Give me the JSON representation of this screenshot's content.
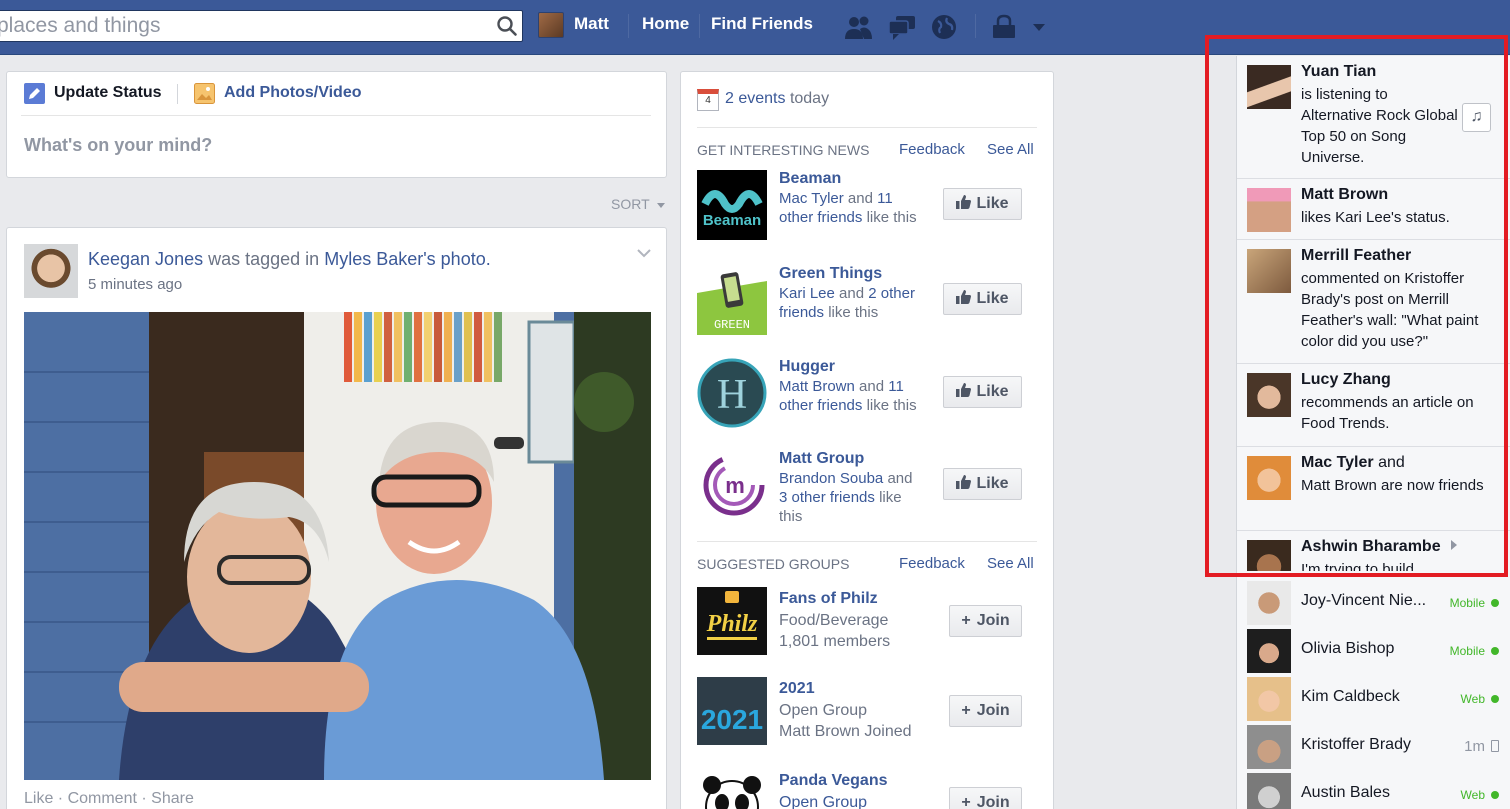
{
  "header": {
    "search_placeholder": "places and things",
    "user_name": "Matt",
    "home": "Home",
    "find_friends": "Find Friends"
  },
  "composer": {
    "update_status": "Update Status",
    "add_photos": "Add Photos/Video",
    "placeholder": "What's on your mind?"
  },
  "feed": {
    "sort": "SORT",
    "story": {
      "actor": "Keegan Jones",
      "verb": "was tagged in",
      "object": "Myles Baker's photo.",
      "time": "5 minutes ago",
      "actions": "Like · Comment · Share"
    }
  },
  "rhs": {
    "events_count": "2 events",
    "events_suffix": "today",
    "events_day": "4",
    "news": {
      "title": "GET INTERESTING NEWS",
      "feedback": "Feedback",
      "see_all": "See All",
      "like_label": "Like",
      "pages": [
        {
          "name": "Beaman",
          "friends": "Mac Tyler",
          "and": "and",
          "others": "11 other friends",
          "tail": "like this",
          "logo_text": "Beaman"
        },
        {
          "name": "Green Things",
          "friends": "Kari Lee",
          "and": "and",
          "others": "2 other friends",
          "tail": "like this",
          "logo_text": "GREEN"
        },
        {
          "name": "Hugger",
          "friends": "Matt Brown",
          "and": "and",
          "others": "11 other friends",
          "tail": "like this",
          "logo_text": "H"
        },
        {
          "name": "Matt Group",
          "friends": "Brandon Souba",
          "and": "and",
          "others": "3 other friends",
          "tail": "like this",
          "logo_text": "m"
        }
      ]
    },
    "groups": {
      "title": "SUGGESTED GROUPS",
      "feedback": "Feedback",
      "see_all": "See All",
      "join_label": "Join",
      "items": [
        {
          "name": "Fans of Philz",
          "line1": "Food/Beverage",
          "line2": "1,801 members",
          "logo_text": "Philz"
        },
        {
          "name": "2021",
          "line1": "Open Group",
          "line2": "Matt Brown Joined",
          "logo_text": "2021"
        },
        {
          "name": "Panda Vegans",
          "line1": "Open Group",
          "line2": ""
        }
      ]
    }
  },
  "ticker": [
    {
      "name": "Yuan Tian",
      "text": "is listening to Alternative Rock Global Top 50 on Song Universe.",
      "avatar": "#3a2a22"
    },
    {
      "name": "Matt Brown",
      "text": "likes Kari Lee's status.",
      "avatar": "#d77a9a"
    },
    {
      "name": "Merrill Feather",
      "text": "commented on Kristoffer Brady's post on Merrill Feather's wall: \"What paint color did you use?\"",
      "avatar": "#b88660"
    },
    {
      "name": "Lucy Zhang",
      "text": "recommends an article on Food Trends.",
      "avatar": "#6d5646"
    },
    {
      "name": "Mac Tyler",
      "name_suffix": "and",
      "text": "Matt Brown are now friends",
      "avatar": "#e0903a"
    },
    {
      "name": "Ashwin Bharambe",
      "text": "I'm trying to build",
      "avatar": "#5a3d2b"
    }
  ],
  "chat": [
    {
      "name": "Joy-Vincent Nie...",
      "status": "Mobile",
      "kind": "mobile",
      "avatar": "#8a6a52"
    },
    {
      "name": "Olivia Bishop",
      "status": "Mobile",
      "kind": "mobile",
      "avatar": "#2a2a2a"
    },
    {
      "name": "Kim Caldbeck",
      "status": "Web",
      "kind": "web",
      "avatar": "#e6c08a"
    },
    {
      "name": "Kristoffer Brady",
      "status": "1m",
      "kind": "idle",
      "avatar": "#7b6b5e"
    },
    {
      "name": "Austin Bales",
      "status": "Web",
      "kind": "web",
      "avatar": "#9a9a9a"
    }
  ],
  "colors": {
    "brand": "#3b5998",
    "highlight_box": "#e31c23",
    "online": "#42b72a"
  }
}
